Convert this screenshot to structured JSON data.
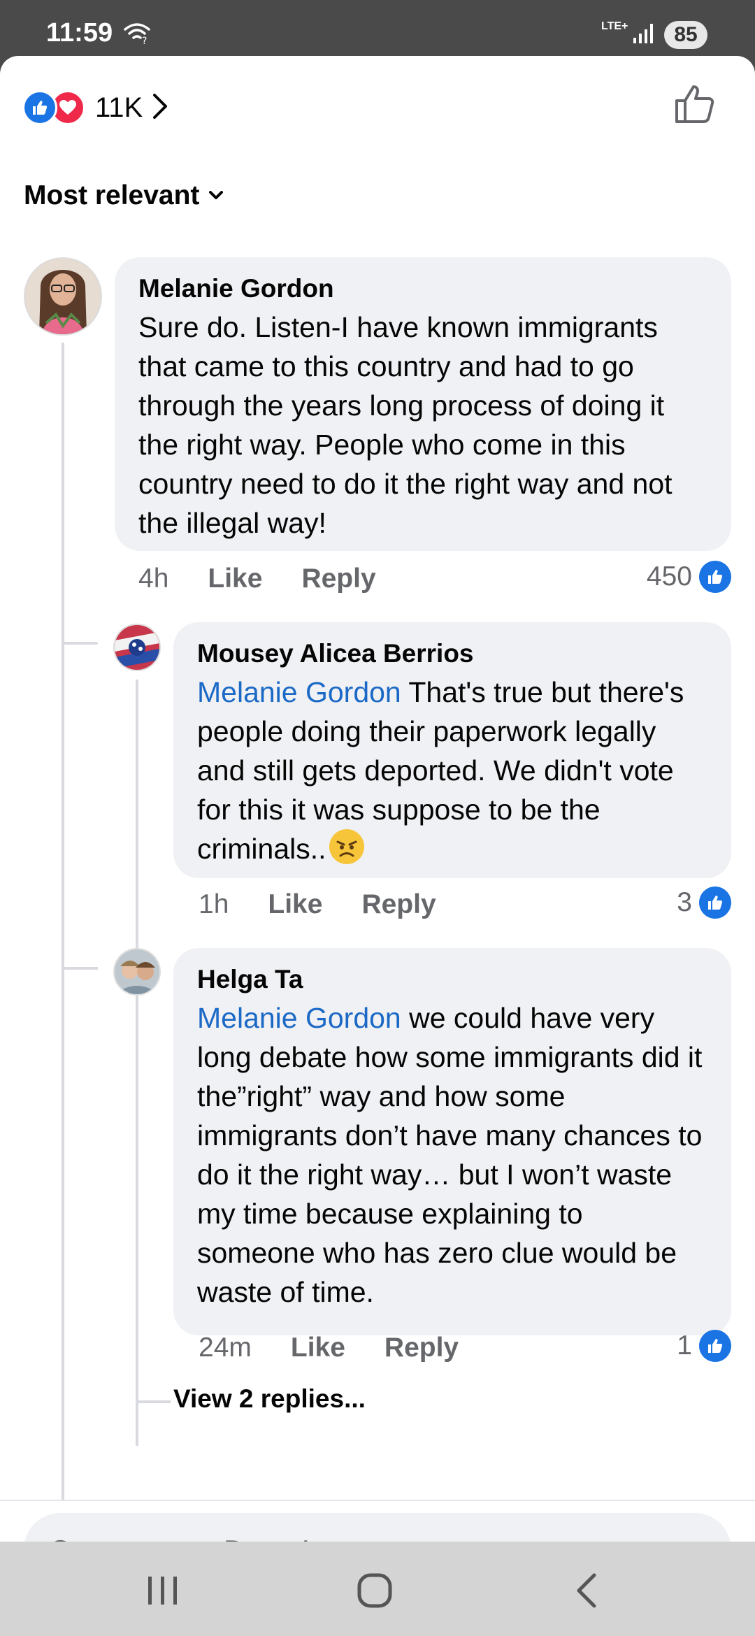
{
  "status": {
    "time": "11:59",
    "network": "LTE+",
    "battery": "85"
  },
  "reactions": {
    "count": "11K"
  },
  "sort": {
    "label": "Most relevant"
  },
  "comments": [
    {
      "author": "Melanie Gordon",
      "text": "Sure do. Listen-I have known immigrants that came to this country and had to go through the years long process of doing it the right way. People who come in this country need to do it the right way and not the illegal way!",
      "time": "4h",
      "like_label": "Like",
      "reply_label": "Reply",
      "likes": "450"
    },
    {
      "author": "Mousey Alicea Berrios",
      "mention": "Melanie Gordon",
      "text": " That's true but there's people doing their paperwork legally and still gets deported. We didn't vote for this it was suppose to be the criminals..",
      "emoji": "angry-face",
      "time": "1h",
      "like_label": "Like",
      "reply_label": "Reply",
      "likes": "3"
    },
    {
      "author": "Helga Ta",
      "mention": "Melanie Gordon",
      "text": " we could have very long debate how some immigrants did it the”right” way and how some immigrants don’t have many chances to do it the right way… but I won’t waste my time because explaining to someone who has zero clue would be waste of time.",
      "time": "24m",
      "like_label": "Like",
      "reply_label": "Reply",
      "likes": "1"
    }
  ],
  "view_replies": "View 2 replies...",
  "input": {
    "placeholder": "Comment as Dean Larsen"
  },
  "colors": {
    "like_blue": "#1b74e4",
    "love_red": "#f02849",
    "mention_blue": "#1b69c6",
    "bubble": "#f0f1f4"
  }
}
